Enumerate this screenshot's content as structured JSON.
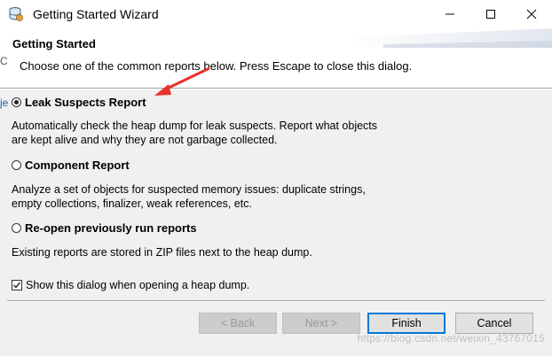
{
  "window": {
    "title": "Getting Started Wizard",
    "icon": "eclipse-mat-icon"
  },
  "header": {
    "title": "Getting Started",
    "description": "Choose one of the common reports below. Press Escape to close this dialog."
  },
  "background_fragments": {
    "c": "C",
    "j": "je"
  },
  "options": [
    {
      "label": "Leak Suspects Report",
      "checked": true,
      "desc_lines": [
        "Automatically check the heap dump for leak suspects. Report what objects",
        "are kept alive and why they are not garbage collected."
      ]
    },
    {
      "label": "Component Report",
      "checked": false,
      "desc_lines": [
        "Analyze a set of objects for suspected memory issues: duplicate strings,",
        "empty collections, finalizer, weak references, etc."
      ]
    },
    {
      "label": "Re-open previously run reports",
      "checked": false,
      "desc_lines": [
        "Existing reports are stored in ZIP files next to the heap dump."
      ]
    }
  ],
  "show_dialog": {
    "label": "Show this dialog when opening a heap dump.",
    "checked": true
  },
  "buttons": {
    "back": "< Back",
    "next": "Next >",
    "finish": "Finish",
    "cancel": "Cancel"
  },
  "watermark": "https://blog.csdn.net/weixin_43767015",
  "colors": {
    "annotation_arrow": "#e8312a",
    "default_button_border": "#0078d7",
    "content_bg": "#f0f0f0"
  }
}
